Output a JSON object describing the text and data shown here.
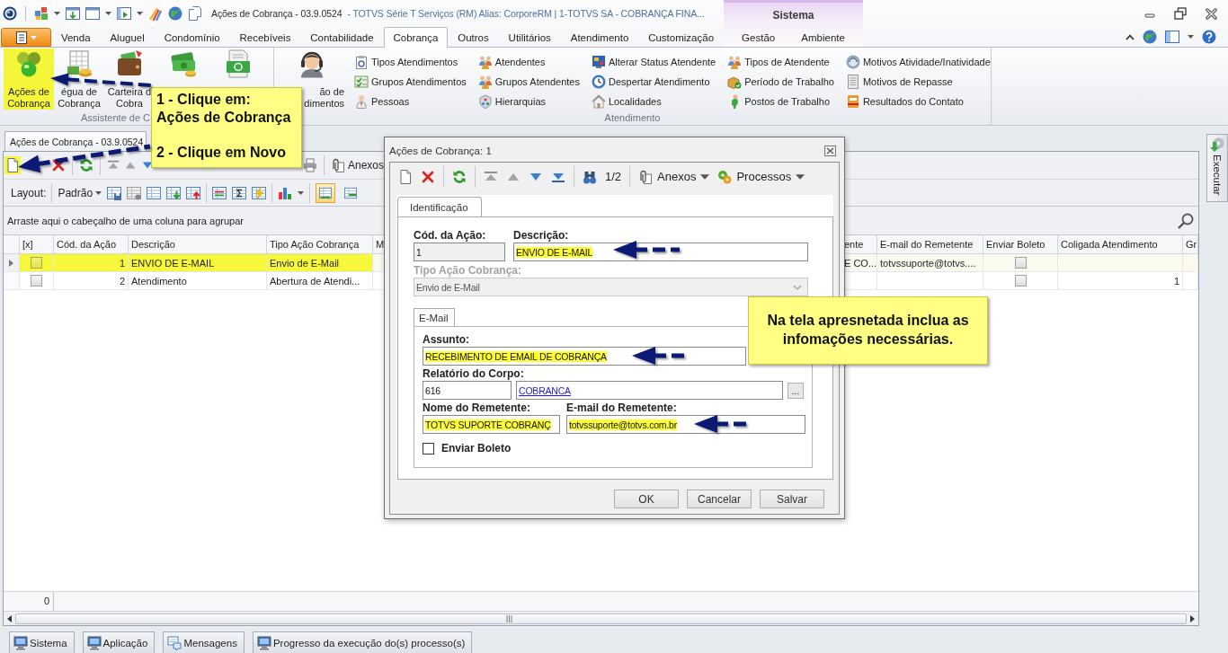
{
  "window": {
    "title_document": "Ações de Cobrança - 03.9.0524",
    "title_app": "- TOTVS Série T Serviços (RM) Alias: CorporeRM | 1-TOTVS SA - COBRANÇA FINA..."
  },
  "ribbon": {
    "tabs": [
      {
        "label": "Venda",
        "selected": false
      },
      {
        "label": "Aluguel",
        "selected": false
      },
      {
        "label": "Condomínio",
        "selected": false
      },
      {
        "label": "Recebíveis",
        "selected": false
      },
      {
        "label": "Contabilidade",
        "selected": false
      },
      {
        "label": "Cobrança",
        "selected": true
      },
      {
        "label": "Outros",
        "selected": false
      },
      {
        "label": "Utilitários",
        "selected": false
      },
      {
        "label": "Atendimento",
        "selected": false
      },
      {
        "label": "Customização",
        "selected": false
      }
    ],
    "context_group": {
      "label": "Sistema",
      "tabs": [
        {
          "label": "Gestão",
          "selected": false
        },
        {
          "label": "Ambiente",
          "selected": false
        }
      ]
    },
    "groups": [
      {
        "label": "Assistente de C",
        "large_buttons": [
          {
            "lines": [
              "Ações de",
              "Cobrança"
            ],
            "highlighted": true
          },
          {
            "lines": [
              "égua de",
              "Cobrança"
            ],
            "highlighted": false
          },
          {
            "lines": [
              "Carteira d",
              "Cobra"
            ],
            "highlighted": false
          },
          {
            "highlighted": false
          },
          {
            "highlighted": false
          }
        ]
      },
      {
        "label": "Atendimento",
        "large_buttons": [
          {
            "lines": [
              "ão de",
              "dimentos"
            ],
            "highlighted": false
          }
        ],
        "columns": [
          [
            "Tipos Atendimentos",
            "Grupos Atendimentos",
            "Pessoas"
          ],
          [
            "Atendentes",
            "Grupos Atendentes",
            "Hierarquias"
          ],
          [
            "Alterar Status Atendente",
            "Despertar Atendimento",
            "Localidades"
          ],
          [
            "Tipos de Atendente",
            "Período de Trabalho",
            "Postos de Trabalho"
          ],
          [
            "Motivos Atividade/Inatividade",
            "Motivos de Repasse",
            "Resultados do Contato"
          ]
        ]
      }
    ]
  },
  "document_tabs": [
    {
      "label": "Ações de Cobrança - 03.9.0524",
      "selected": true
    }
  ],
  "toolbar": {
    "new_highlighted": true,
    "attachments": "Anexos"
  },
  "layout_bar": {
    "label": "Layout:",
    "preset": "Padrão",
    "view_toggles": [
      {
        "on": true
      },
      {
        "on": false
      }
    ]
  },
  "grid": {
    "group_hint": "Arraste aqui o cabeçalho de uma coluna para agrupar",
    "columns": [
      "[x]",
      "Cód. da Ação",
      "Descrição",
      "Tipo Ação Cobrança",
      "M",
      "ente",
      "E-mail do Remetente",
      "Enviar Boleto",
      "Coligada Atendimento",
      "Gr"
    ],
    "rows": [
      {
        "selected": true,
        "highlighted": true,
        "cells": [
          {
            "kind": "check",
            "checked": false
          },
          {
            "kind": "number",
            "text": "1"
          },
          {
            "kind": "text",
            "text": "ENVIO DE E-MAIL"
          },
          {
            "kind": "text",
            "text": "Envio de E-Mail"
          },
          {
            "kind": "blank"
          },
          {
            "kind": "text",
            "text": "E CO..."
          },
          {
            "kind": "text",
            "text": "totvssuporte@totvs...."
          },
          {
            "kind": "check",
            "checked": false
          },
          {
            "kind": "blank"
          },
          {
            "kind": "blank"
          }
        ]
      },
      {
        "selected": false,
        "highlighted": false,
        "cells": [
          {
            "kind": "check",
            "checked": false
          },
          {
            "kind": "number",
            "text": "2"
          },
          {
            "kind": "text",
            "text": "Atendimento"
          },
          {
            "kind": "text",
            "text": "Abertura de Atendi..."
          },
          {
            "kind": "blank"
          },
          {
            "kind": "blank"
          },
          {
            "kind": "blank"
          },
          {
            "kind": "check",
            "checked": false
          },
          {
            "kind": "number",
            "text": "1"
          },
          {
            "kind": "blank"
          }
        ]
      }
    ],
    "footer_count": "0"
  },
  "side_tabs": [
    {
      "label": "Executar"
    }
  ],
  "taskbar": [
    {
      "label": "Sistema"
    },
    {
      "label": "Aplicação"
    },
    {
      "label": "Mensagens"
    },
    {
      "label": "Progresso da execução do(s) processo(s)"
    }
  ],
  "dialog": {
    "title": "Ações de Cobrança: 1",
    "counter": "1/2",
    "menus": [
      "Anexos",
      "Processos"
    ],
    "tabs": [
      {
        "label": "Identificação",
        "selected": true
      }
    ],
    "cod": {
      "label": "Cód. da Ação:",
      "value": "1",
      "readonly": true,
      "highlighted": false
    },
    "descricao": {
      "label": "Descrição:",
      "value": "ENVIO DE E-MAIL",
      "readonly": false,
      "highlighted": true
    },
    "tipo": {
      "label": "Tipo Ação Cobrança:",
      "value": "Envio de E-Mail",
      "disabled": true
    },
    "subtabs": [
      {
        "label": "E-Mail",
        "selected": true
      }
    ],
    "assunto": {
      "label": "Assunto:",
      "value": "RECEBIMENTO DE EMAIL DE COBRANÇA",
      "readonly": false,
      "highlighted": true
    },
    "relatorio": {
      "label": "Relatório do Corpo:",
      "code": "616",
      "name": {
        "kind": "link",
        "text": "COBRANCA"
      },
      "browse": "..."
    },
    "nome_remetente": {
      "label": "Nome do Remetente:",
      "value": "TOTVS SUPORTE COBRANÇ",
      "readonly": false,
      "highlighted": true
    },
    "email_remetente": {
      "label": "E-mail do Remetente:",
      "value": "totvssuporte@totvs.com.br",
      "readonly": false,
      "highlighted": true
    },
    "enviar_boleto": {
      "label": "Enviar Boleto",
      "checked": false
    },
    "buttons": [
      "OK",
      "Cancelar",
      "Salvar"
    ]
  },
  "callouts": [
    {
      "paragraphs": [
        [
          "1 - Clique em:",
          "Ações de Cobrança"
        ],
        [
          "2 - Clique em Novo"
        ]
      ]
    },
    {
      "paragraphs": [
        [
          "Na tela apresnetada inclua as",
          "infomações necessárias."
        ]
      ]
    }
  ]
}
